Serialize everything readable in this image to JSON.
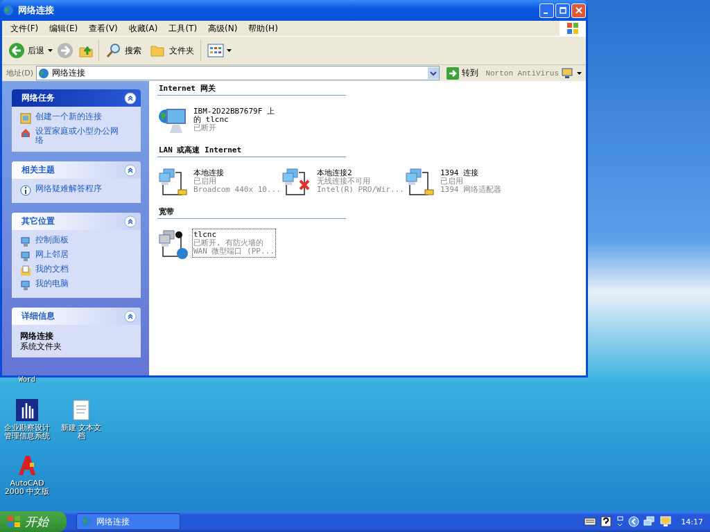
{
  "window": {
    "title": "网络连接"
  },
  "menu": [
    "文件(F)",
    "编辑(E)",
    "查看(V)",
    "收藏(A)",
    "工具(T)",
    "高级(N)",
    "帮助(H)"
  ],
  "toolbar": {
    "back": "后退",
    "search": "搜索",
    "folders": "文件夹"
  },
  "address": {
    "label": "地址(D)",
    "value": "网络连接",
    "go": "转到",
    "norton": "Norton AntiVirus"
  },
  "sidebar": [
    {
      "title": "网络任务",
      "kind": "active",
      "items": [
        {
          "label": "创建一个新的连接",
          "kind": "wizard"
        },
        {
          "label": "设置家庭或小型办公网络",
          "kind": "home"
        }
      ]
    },
    {
      "title": "相关主题",
      "kind": "normal",
      "items": [
        {
          "label": "网络疑难解答程序",
          "kind": "info"
        }
      ]
    },
    {
      "title": "其它位置",
      "kind": "normal",
      "items": [
        {
          "label": "控制面板",
          "kind": "control"
        },
        {
          "label": "网上邻居",
          "kind": "network"
        },
        {
          "label": "我的文档",
          "kind": "docs"
        },
        {
          "label": "我的电脑",
          "kind": "computer"
        }
      ]
    }
  ],
  "details": {
    "title": "详细信息",
    "name": "网络连接",
    "desc": "系统文件夹"
  },
  "groups": [
    {
      "title": "Internet 网关",
      "items": [
        {
          "kind": "gateway",
          "name": "IBM-2D22BB7679F 上的 tlcnc",
          "status": "已断开",
          "selected": false
        }
      ]
    },
    {
      "title": "LAN 或高速 Internet",
      "items": [
        {
          "kind": "lan",
          "name": "本地连接",
          "status": "已启用",
          "device": "Broadcom 440x 10...",
          "selected": false
        },
        {
          "kind": "wireless",
          "name": "本地连接2",
          "status": "无线连接不可用",
          "device": "Intel(R) PRO/Wir...",
          "selected": false
        },
        {
          "kind": "lan",
          "name": "1394 连接",
          "status": "已启用",
          "device": "1394 网络适配器",
          "selected": false
        }
      ]
    },
    {
      "title": "宽带",
      "items": [
        {
          "kind": "broadband",
          "name": "tlcnc",
          "status": "已断开, 有防火墙的",
          "device": "WAN 微型端口 (PP...",
          "selected": true
        }
      ]
    }
  ],
  "desktop_icons": [
    {
      "label": "Word",
      "kind": "partial"
    },
    {
      "label": "企业勘察设计管理信息系统",
      "kind": "app"
    },
    {
      "label": "新建 文本文档",
      "kind": "text"
    },
    {
      "label": "AutoCAD 2000 中文版",
      "kind": "cad"
    }
  ],
  "taskbar": {
    "start": "开始",
    "tasks": [
      {
        "label": "网络连接",
        "selected": false
      }
    ],
    "clock": "14:17"
  }
}
